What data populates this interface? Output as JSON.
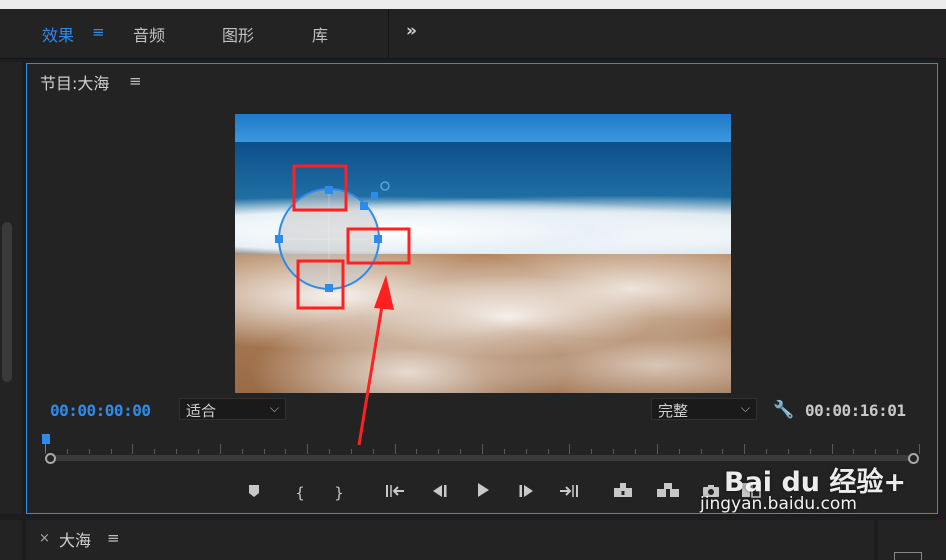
{
  "tabs": [
    {
      "label": "效果",
      "active": true
    },
    {
      "label": "音频",
      "active": false
    },
    {
      "label": "图形",
      "active": false
    },
    {
      "label": "库",
      "active": false
    }
  ],
  "tab_menu_icon": "hamburger-icon",
  "tab_overflow": "»",
  "program_monitor": {
    "title": "节目:大海",
    "menu_icon": "≡",
    "timecode_current": "00:00:00:00",
    "zoom_select": "适合",
    "quality_select": "完整",
    "timecode_duration": "00:00:16:01"
  },
  "transport_icons": [
    "add-marker-icon",
    "mark-in-icon",
    "mark-out-icon",
    "go-to-in-icon",
    "step-back-icon",
    "play-icon",
    "step-forward-icon",
    "go-to-out-icon",
    "lift-icon",
    "extract-icon",
    "export-frame-icon",
    "compare-icon"
  ],
  "sequence_tab": {
    "close": "×",
    "label": "大海",
    "menu_icon": "≡"
  },
  "watermark": {
    "logo": "Bai du 经验+",
    "url": "jingyan.baidu.com"
  },
  "colors": {
    "accent": "#2d8ceb",
    "annotation": "#ff2020",
    "panel": "#232323"
  }
}
